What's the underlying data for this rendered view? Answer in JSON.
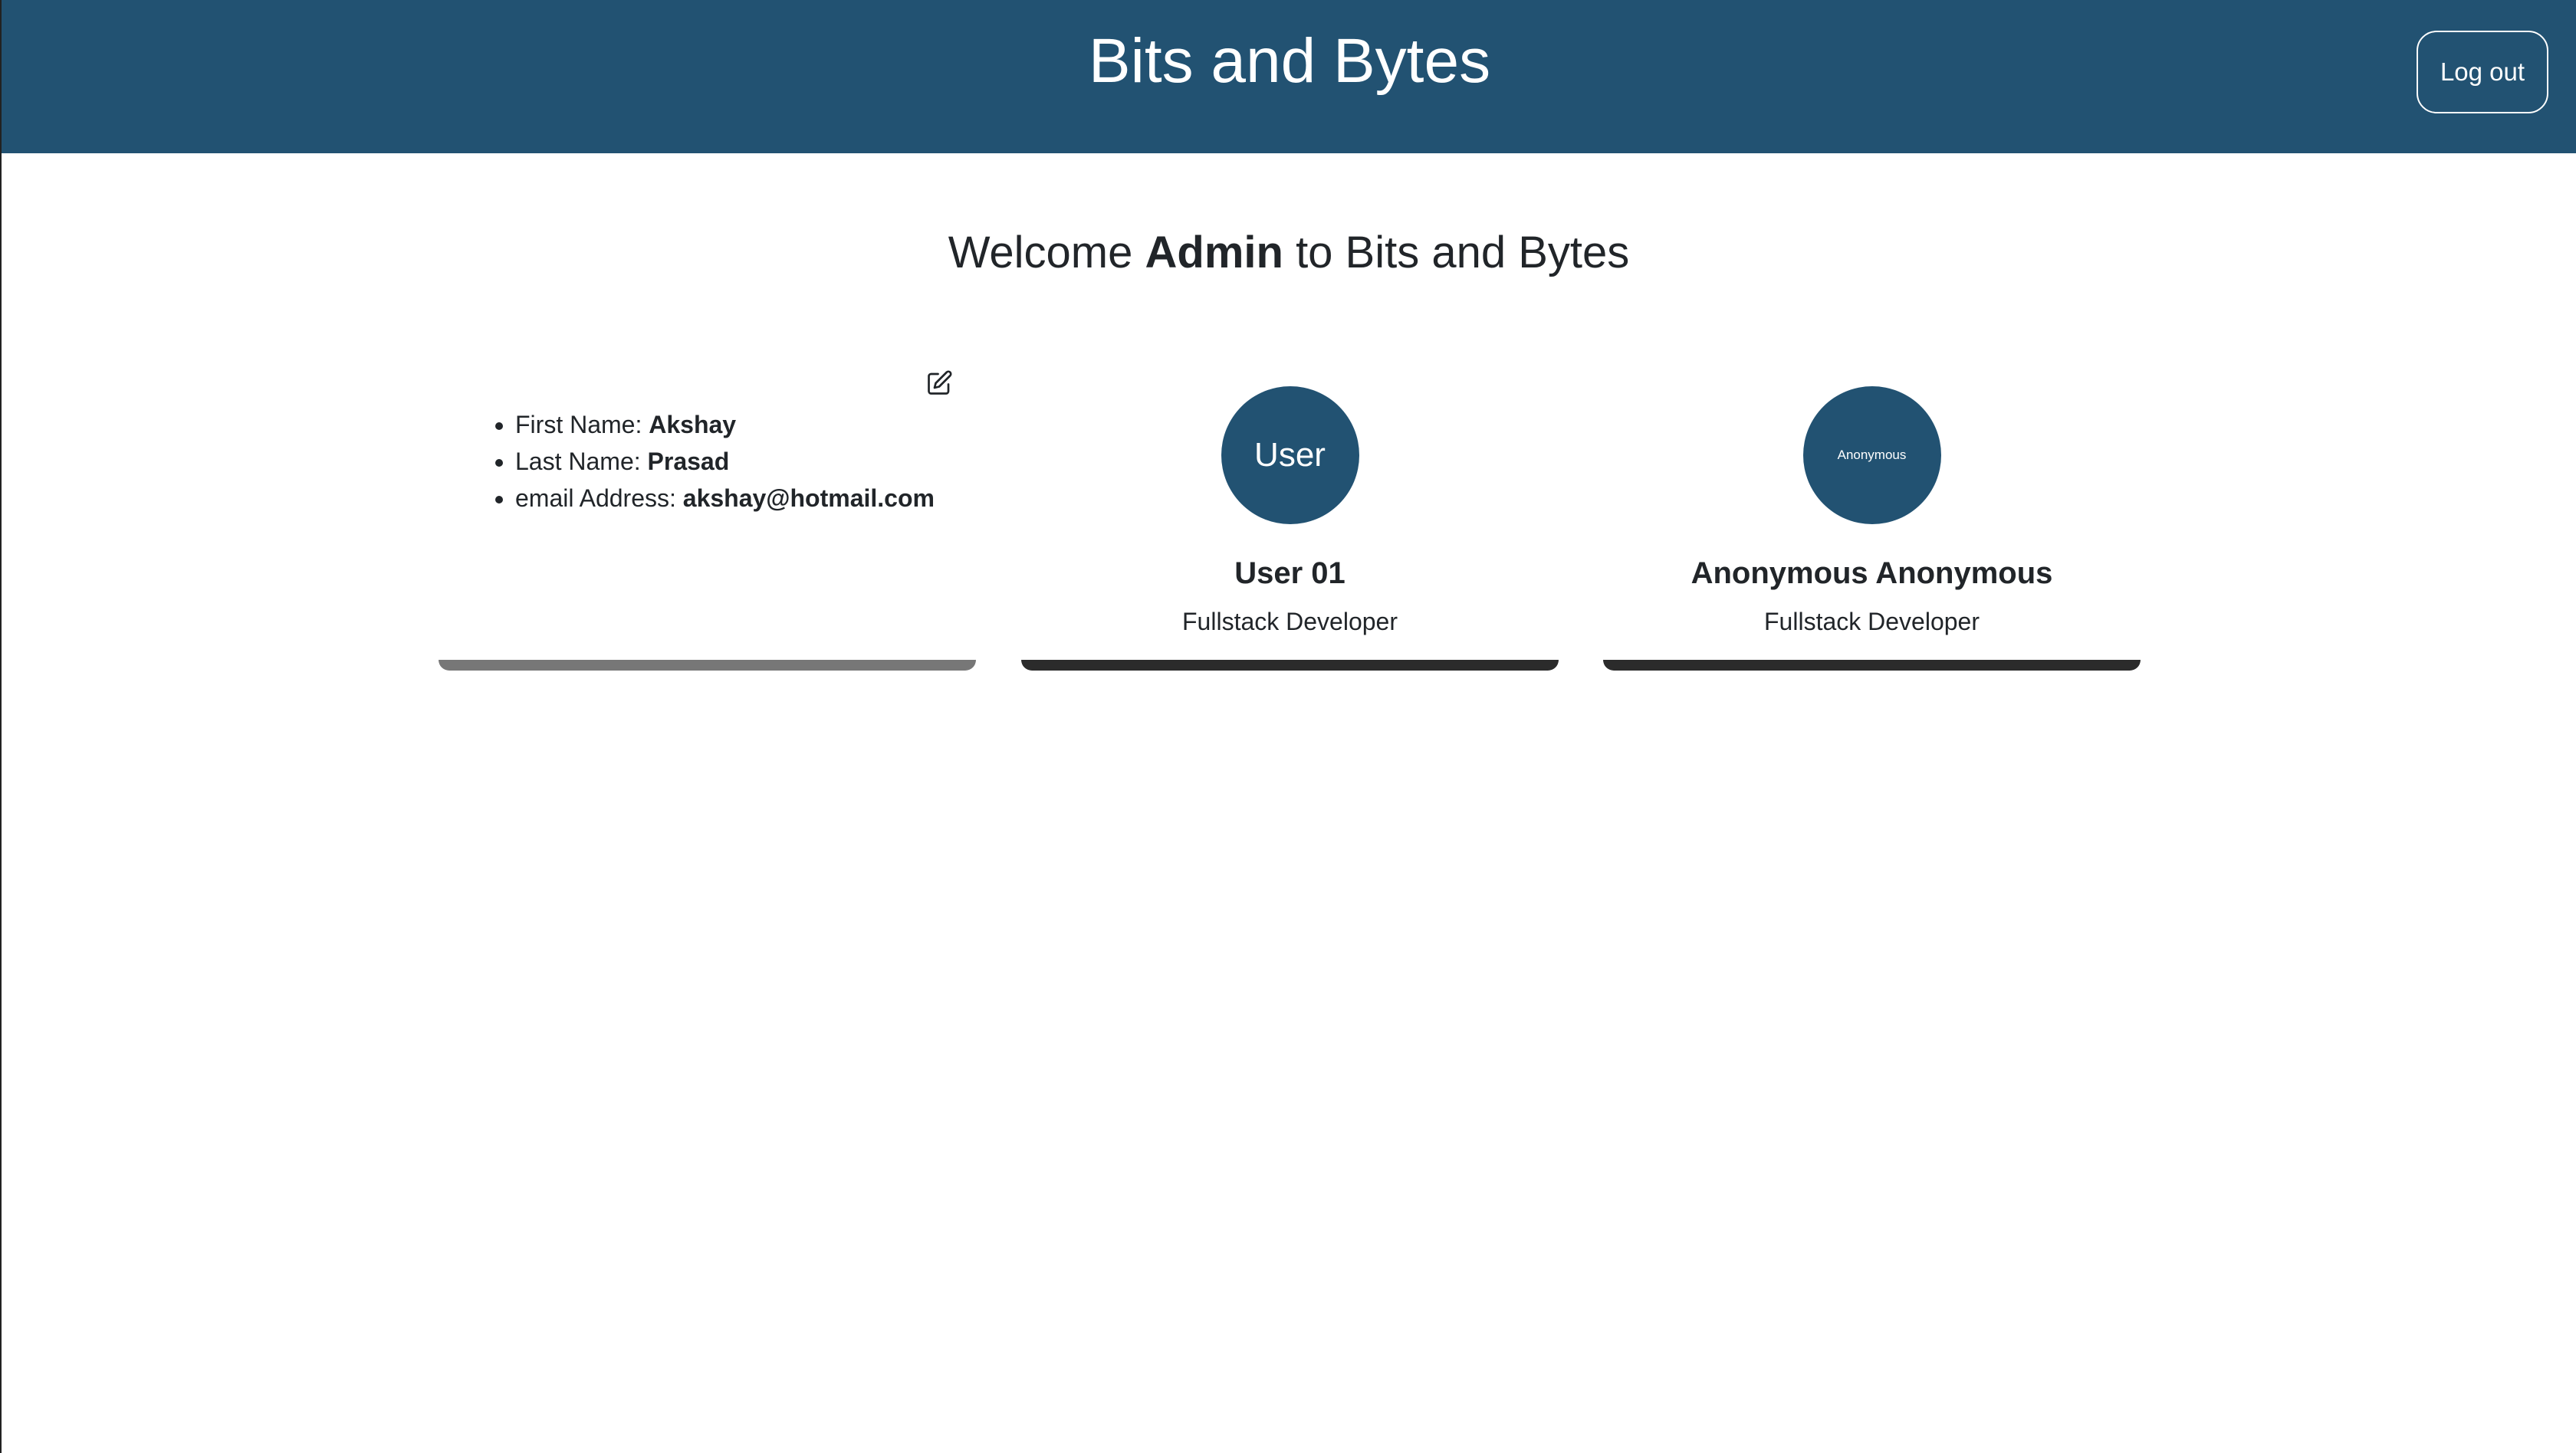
{
  "header": {
    "brand": "Bits and Bytes",
    "logout_label": "Log out"
  },
  "welcome": {
    "prefix": "Welcome",
    "name": "Admin",
    "suffix": "to Bits and Bytes"
  },
  "admin_card": {
    "edit_icon": "edit-icon",
    "fields": [
      {
        "label": "First Name:",
        "value": "Akshay"
      },
      {
        "label": "Last Name:",
        "value": "Prasad"
      },
      {
        "label": "email Address:",
        "value": "akshay@hotmail.com"
      }
    ]
  },
  "profiles": [
    {
      "avatar_text": "User",
      "name": "User 01",
      "role": "Fullstack Developer"
    },
    {
      "avatar_text": "Anonymous",
      "name": "Anonymous Anonymous",
      "role": "Fullstack Developer"
    }
  ],
  "colors": {
    "navbar": "#225272",
    "avatar": "#225272",
    "text": "#212529"
  }
}
